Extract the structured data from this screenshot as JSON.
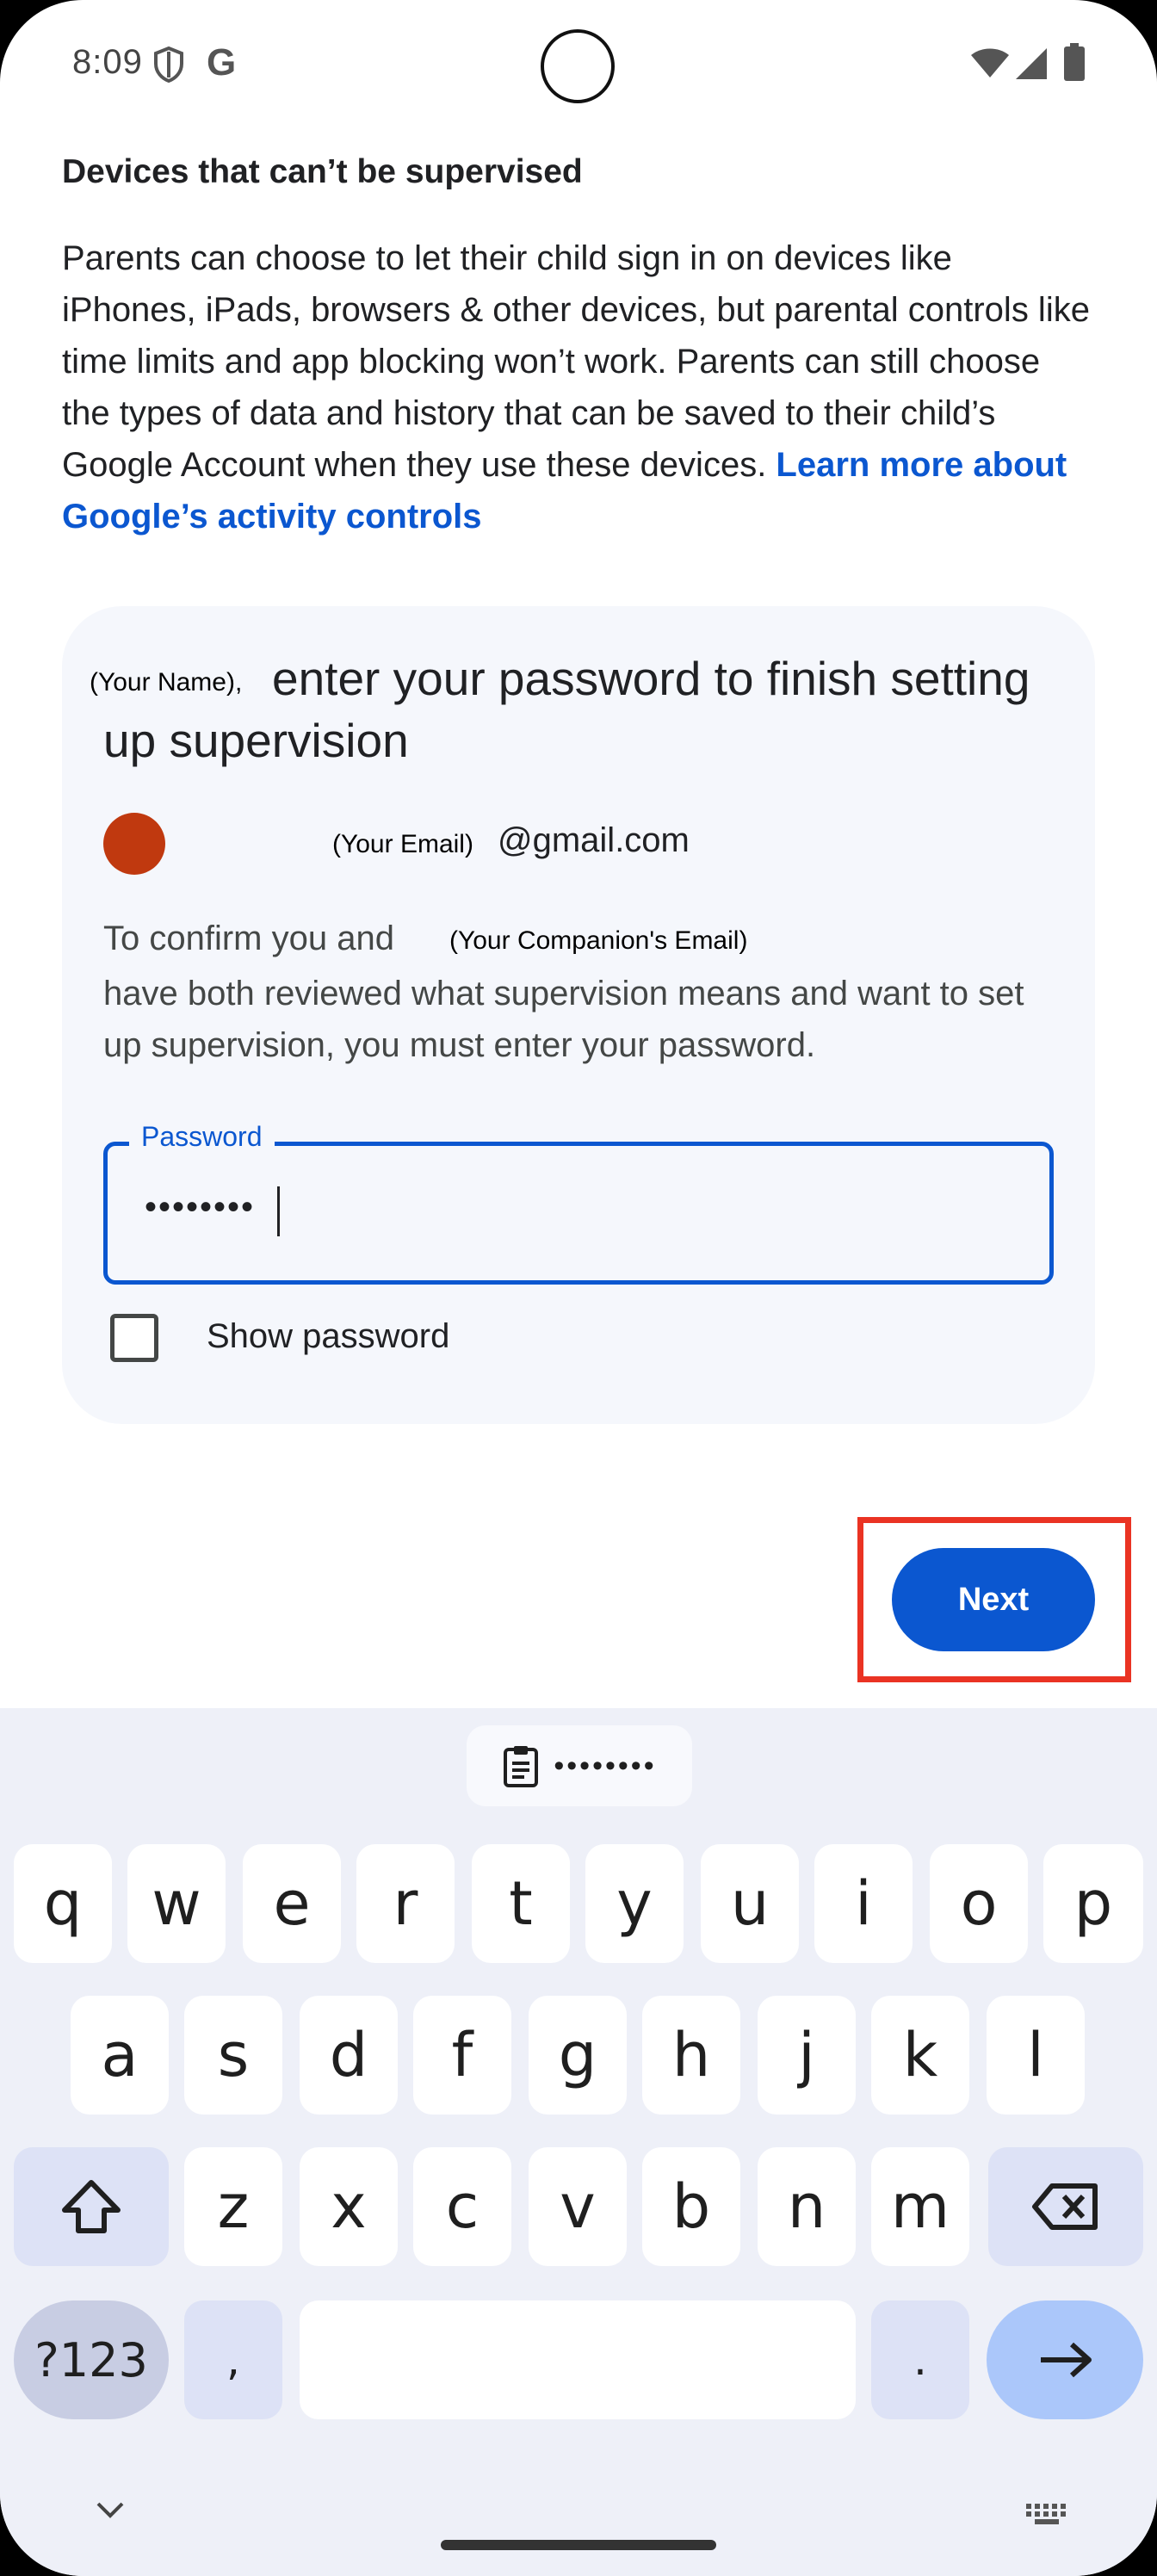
{
  "status_bar": {
    "time": "8:09",
    "g_label": "G"
  },
  "content": {
    "section_title": "Devices that can’t be supervised",
    "body": "Parents can choose to let their child sign in on devices like iPhones, iPads, browsers & other devices, but parental controls like time limits and app blocking won’t work. Parents can still choose the types of data and history that can be saved to their child’s Google Account when they use these devices. ",
    "link": "Learn more about Google’s activity controls"
  },
  "card": {
    "name_tag": "(Your Name),",
    "title": "enter your password to finish setting up supervision",
    "email_tag": "(Your Email)",
    "email_domain": "@gmail.com",
    "confirm_prefix": "To confirm you and",
    "companion_tag": "(Your Companion's Email)",
    "confirm_rest": "have both reviewed what supervision means and want to set up supervision, you must enter your password.",
    "password_label": "Password",
    "password_value": "••••••••",
    "show_password_label": "Show password"
  },
  "actions": {
    "next_label": "Next"
  },
  "keyboard": {
    "clipboard_text": "••••••••",
    "row1": [
      "q",
      "w",
      "e",
      "r",
      "t",
      "y",
      "u",
      "i",
      "o",
      "p"
    ],
    "row2": [
      "a",
      "s",
      "d",
      "f",
      "g",
      "h",
      "j",
      "k",
      "l"
    ],
    "row3": [
      "z",
      "x",
      "c",
      "v",
      "b",
      "n",
      "m"
    ],
    "symbols_label": "?123",
    "comma": ",",
    "period": "."
  },
  "colors": {
    "accent": "#0b57d0",
    "highlight": "#ea3323",
    "avatar": "#c0390f"
  }
}
